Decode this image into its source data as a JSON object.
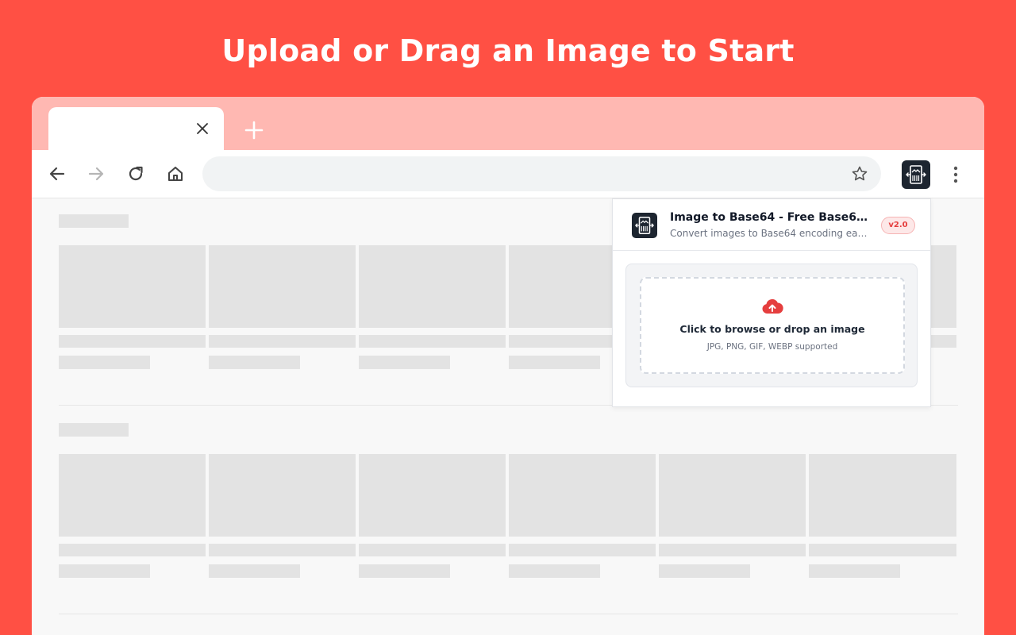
{
  "headline": "Upload or Drag an Image to Start",
  "browser": {
    "tab_close_icon": "close-icon",
    "new_tab_icon": "plus-icon",
    "nav_icons": [
      "back-arrow-icon",
      "forward-arrow-icon",
      "reload-icon",
      "home-icon"
    ],
    "bookmark_icon": "star-icon",
    "menu_icon": "kebab-menu-icon"
  },
  "popup": {
    "title": "Image to Base64 - Free Base64 Encoder",
    "subtitle": "Convert images to Base64 encoding easily",
    "version": "v2.0",
    "dropzone": {
      "icon": "cloud-upload-icon",
      "title": "Click to browse or drop an image",
      "formats": "JPG, PNG, GIF, WEBP supported"
    }
  },
  "colors": {
    "background": "#ff5044",
    "tabstrip": "#ffb8b2",
    "accent_red": "#e53e3e",
    "extension_dark": "#1d2530"
  }
}
